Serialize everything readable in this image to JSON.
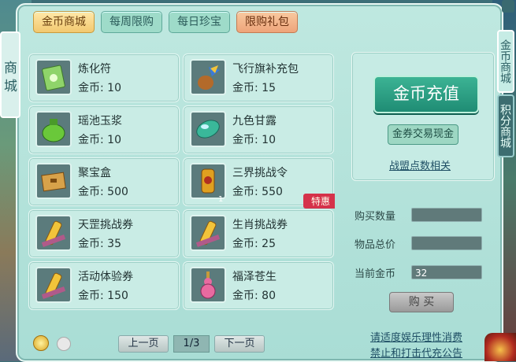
{
  "side_tab": "商城",
  "tabs": [
    {
      "label": "金币商城",
      "active": true
    },
    {
      "label": "每周限购",
      "active": false
    },
    {
      "label": "每日珍宝",
      "active": false
    },
    {
      "label": "限购礼包",
      "active": false
    }
  ],
  "right_tabs": [
    "金币商城",
    "积分商城"
  ],
  "items": [
    {
      "name": "炼化符",
      "price": "金币: 10",
      "icon": "scroll-talisman-icon"
    },
    {
      "name": "飞行旗补充包",
      "price": "金币: 15",
      "icon": "flag-pack-icon"
    },
    {
      "name": "瑶池玉浆",
      "price": "金币: 10",
      "icon": "jade-jar-icon"
    },
    {
      "name": "九色甘露",
      "price": "金币: 10",
      "icon": "gem-leaf-icon"
    },
    {
      "name": "聚宝盒",
      "price": "金币: 500",
      "icon": "treasure-box-icon"
    },
    {
      "name": "三界挑战令",
      "price": "金币: 550",
      "icon": "token-icon",
      "count": "1",
      "badge": "特惠"
    },
    {
      "name": "天罡挑战券",
      "price": "金币: 35",
      "icon": "scroll-icon"
    },
    {
      "name": "生肖挑战券",
      "price": "金币: 25",
      "icon": "scroll-icon"
    },
    {
      "name": "活动体验券",
      "price": "金币: 150",
      "icon": "scroll-icon"
    },
    {
      "name": "福泽苍生",
      "price": "金币: 80",
      "icon": "gourd-icon"
    }
  ],
  "recharge": "金币充值",
  "exchange": "金券交易现金",
  "league_points": "战盟点数相关",
  "form": {
    "quantity_label": "购买数量",
    "quantity_value": "",
    "total_label": "物品总价",
    "total_value": "",
    "coins_label": "当前金币",
    "coins_value": "32"
  },
  "buy": "购 买",
  "pager": {
    "prev": "上一页",
    "page": "1/3",
    "next": "下一页"
  },
  "notices": [
    "请适度娱乐理性消费",
    "禁止和打击代充公告"
  ]
}
